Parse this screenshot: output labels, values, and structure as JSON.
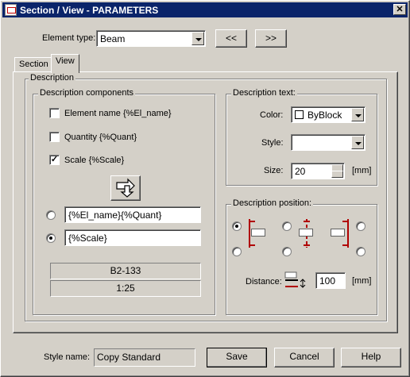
{
  "window": {
    "title": "Section / View - PARAMETERS",
    "close_glyph": "✕"
  },
  "element_type": {
    "label": "Element type:",
    "value": "Beam"
  },
  "nav": {
    "prev_label": "<<",
    "next_label": ">>"
  },
  "tabs": [
    {
      "label": "Section",
      "active": false
    },
    {
      "label": "View",
      "active": true
    }
  ],
  "description": {
    "group_title": "Description",
    "components": {
      "group_title": "Description components",
      "items": [
        {
          "label": "Element name {%El_name}",
          "checked": false
        },
        {
          "label": "Quantity {%Quant}",
          "checked": false
        },
        {
          "label": "Scale {%Scale}",
          "checked": true
        }
      ],
      "insert_icon": "arrow-insert-icon",
      "options": [
        {
          "value": "{%El_name}{%Quant}",
          "selected": false
        },
        {
          "value": "{%Scale}",
          "selected": true
        }
      ],
      "preview_line1": "B2-133",
      "preview_line2": "1:25"
    },
    "text": {
      "group_title": "Description text:",
      "color_label": "Color:",
      "color_value": "ByBlock",
      "style_label": "Style:",
      "style_value": "",
      "size_label": "Size:",
      "size_value": "20",
      "size_unit": "[mm]"
    },
    "position": {
      "group_title": "Description position:",
      "selected_index": 0,
      "distance_label": "Distance:",
      "distance_value": "100",
      "distance_unit": "[mm]"
    }
  },
  "footer": {
    "style_name_label": "Style name:",
    "style_name_value": "Copy Standard",
    "save_label": "Save",
    "cancel_label": "Cancel",
    "help_label": "Help"
  },
  "colors": {
    "title_bar": "#0a246a",
    "face": "#d4d0c8",
    "marker_red": "#b00000"
  }
}
